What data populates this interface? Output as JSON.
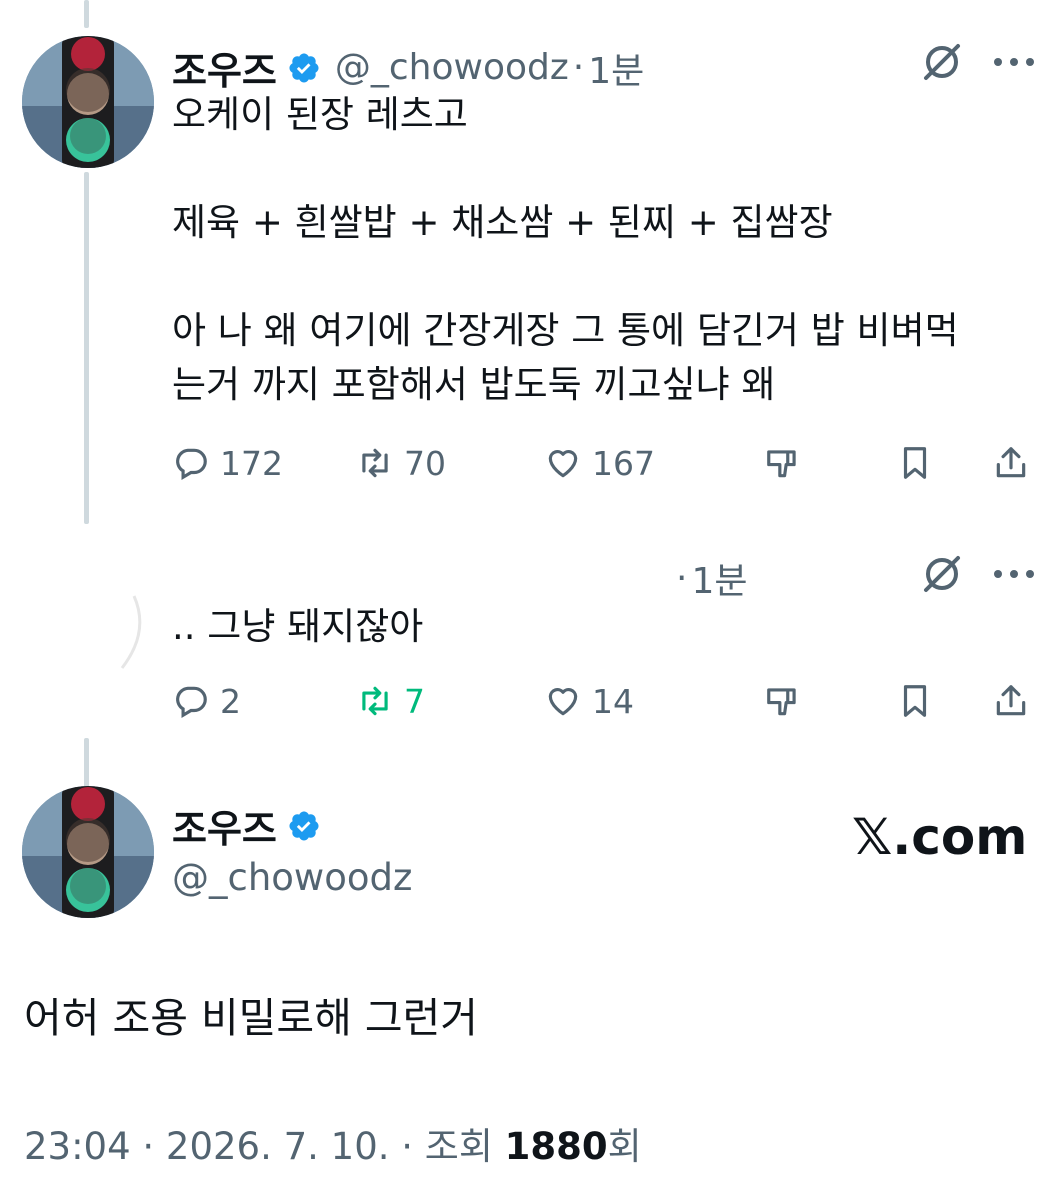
{
  "tweet1": {
    "name": "조우즈",
    "handle": "@_chowoodz",
    "separator": "·",
    "time": "1분",
    "text": "오케이 된장 레츠고\n\n제육 + 흰쌀밥 + 채소쌈 + 된찌 + 집쌈장\n\n아 나 왜 여기에 간장게장 그 통에 담긴거 밥 비벼먹\n는거 까지 포함해서 밥도둑 끼고싶냐 왜",
    "replies": "172",
    "retweets": "70",
    "likes": "167",
    "icons": [
      "grok-icon",
      "more-icon",
      "reply-icon",
      "retweet-icon",
      "like-icon",
      "dislike-icon",
      "bookmark-icon",
      "share-icon"
    ]
  },
  "tweet2": {
    "separator": "·",
    "time": "1분",
    "text": ".. 그냥 돼지잖아",
    "replies": "2",
    "retweets": "7",
    "likes": "14",
    "retweet_color": "#00ba7c"
  },
  "main": {
    "name": "조우즈",
    "handle": "@_chowoodz",
    "watermark": "𝕏.com",
    "text": "어허 조용 비밀로해 그런거",
    "timestamp": "23:04 · 2026. 7. 10. · 조회 ",
    "views": "1880",
    "views_suffix": "회"
  },
  "colors": {
    "verified": "#1d9bf0",
    "secondary_text": "#536471",
    "primary_text": "#0f1419",
    "thread_line": "#cfd9de"
  }
}
